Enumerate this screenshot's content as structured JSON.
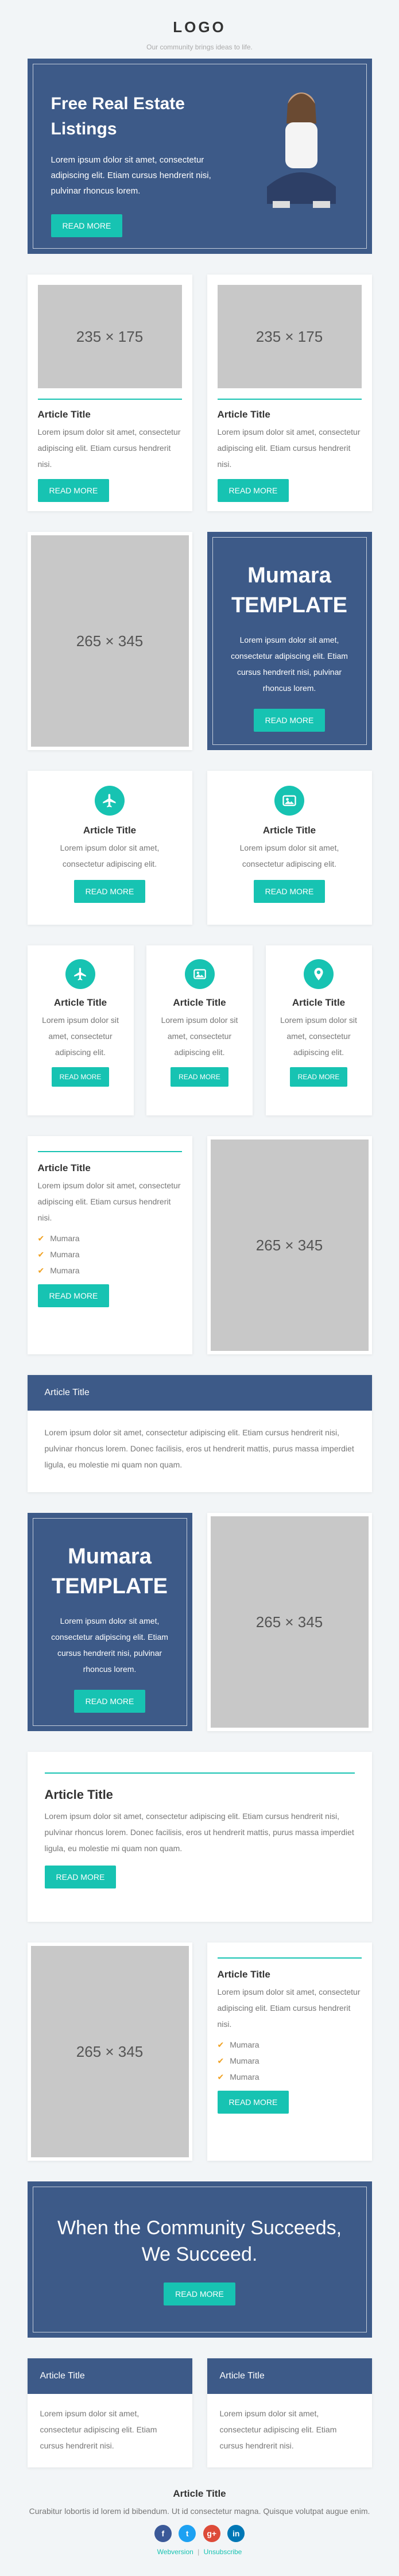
{
  "header": {
    "logo": "LOGO",
    "tagline": "Our community brings ideas to life."
  },
  "hero": {
    "title": "Free Real Estate Listings",
    "body": "Lorem ipsum dolor sit amet, consectetur adipiscing elit. Etiam cursus hendrerit nisi, pulvinar rhoncus lorem.",
    "button": "READ MORE"
  },
  "row1": [
    {
      "ph": "235 × 175",
      "title": "Article Title",
      "body": "Lorem ipsum dolor sit amet, consectetur adipiscing elit. Etiam cursus hendrerit nisi.",
      "button": "READ MORE"
    },
    {
      "ph": "235 × 175",
      "title": "Article Title",
      "body": "Lorem ipsum dolor sit amet, consectetur adipiscing elit. Etiam cursus hendrerit nisi.",
      "button": "READ MORE"
    }
  ],
  "tpl1": {
    "ph": "265 × 345",
    "heading": "Mumara TEMPLATE",
    "body": "Lorem ipsum dolor sit amet, consectetur adipiscing elit. Etiam cursus hendrerit nisi, pulvinar rhoncus lorem.",
    "button": "READ MORE"
  },
  "row2": [
    {
      "title": "Article Title",
      "body": "Lorem ipsum dolor sit amet, consectetur adipiscing elit.",
      "button": "READ MORE"
    },
    {
      "title": "Article Title",
      "body": "Lorem ipsum dolor sit amet, consectetur adipiscing elit.",
      "button": "READ MORE"
    }
  ],
  "row3": [
    {
      "title": "Article Title",
      "body": "Lorem ipsum dolor sit amet, consectetur adipiscing elit.",
      "button": "READ MORE"
    },
    {
      "title": "Article Title",
      "body": "Lorem ipsum dolor sit amet, consectetur adipiscing elit.",
      "button": "READ MORE"
    },
    {
      "title": "Article Title",
      "body": "Lorem ipsum dolor sit amet, consectetur adipiscing elit.",
      "button": "READ MORE"
    }
  ],
  "list1": {
    "title": "Article Title",
    "body": "Lorem ipsum dolor sit amet, consectetur adipiscing elit. Etiam cursus hendrerit nisi.",
    "items": [
      "Mumara",
      "Mumara",
      "Mumara"
    ],
    "button": "READ MORE",
    "ph": "265 × 345"
  },
  "wide1": {
    "title": "Article Title",
    "body": "Lorem ipsum dolor sit amet, consectetur adipiscing elit. Etiam cursus hendrerit nisi, pulvinar rhoncus lorem. Donec facilisis, eros ut hendrerit mattis, purus massa imperdiet ligula, eu molestie mi quam non quam."
  },
  "tpl2": {
    "heading": "Mumara TEMPLATE",
    "body": "Lorem ipsum dolor sit amet, consectetur adipiscing elit. Etiam cursus hendrerit nisi, pulvinar rhoncus lorem.",
    "button": "READ MORE",
    "ph": "265 × 345"
  },
  "wide2": {
    "title": "Article Title",
    "body": "Lorem ipsum dolor sit amet, consectetur adipiscing elit. Etiam cursus hendrerit nisi, pulvinar rhoncus lorem. Donec facilisis, eros ut hendrerit mattis, purus massa imperdiet ligula, eu molestie mi quam non quam.",
    "button": "READ MORE"
  },
  "list2": {
    "ph": "265 × 345",
    "title": "Article Title",
    "body": "Lorem ipsum dolor sit amet, consectetur adipiscing elit. Etiam cursus hendrerit nisi.",
    "items": [
      "Mumara",
      "Mumara",
      "Mumara"
    ],
    "button": "READ MORE"
  },
  "banner": {
    "heading": "When the Community Succeeds, We Succeed.",
    "button": "READ MORE"
  },
  "row4": [
    {
      "head": "Article Title",
      "body": "Lorem ipsum dolor sit amet, consectetur adipiscing elit. Etiam cursus hendrerit nisi."
    },
    {
      "head": "Article Title",
      "body": "Lorem ipsum dolor sit amet, consectetur adipiscing elit. Etiam cursus hendrerit nisi."
    }
  ],
  "footer": {
    "title": "Article Title",
    "body": "Curabitur lobortis id lorem id bibendum. Ut id consectetur magna. Quisque volutpat augue enim.",
    "social": [
      "f",
      "t",
      "g+",
      "in"
    ],
    "webversion": "Webversion",
    "sep": "|",
    "unsubscribe": "Unsubscribe"
  },
  "colors": {
    "accent": "#17c3b2",
    "brand": "#3d5a88",
    "check": "#f0a020",
    "facebook": "#3b5998",
    "twitter": "#1da1f2",
    "google": "#dd4b39",
    "linkedin": "#0077b5"
  }
}
